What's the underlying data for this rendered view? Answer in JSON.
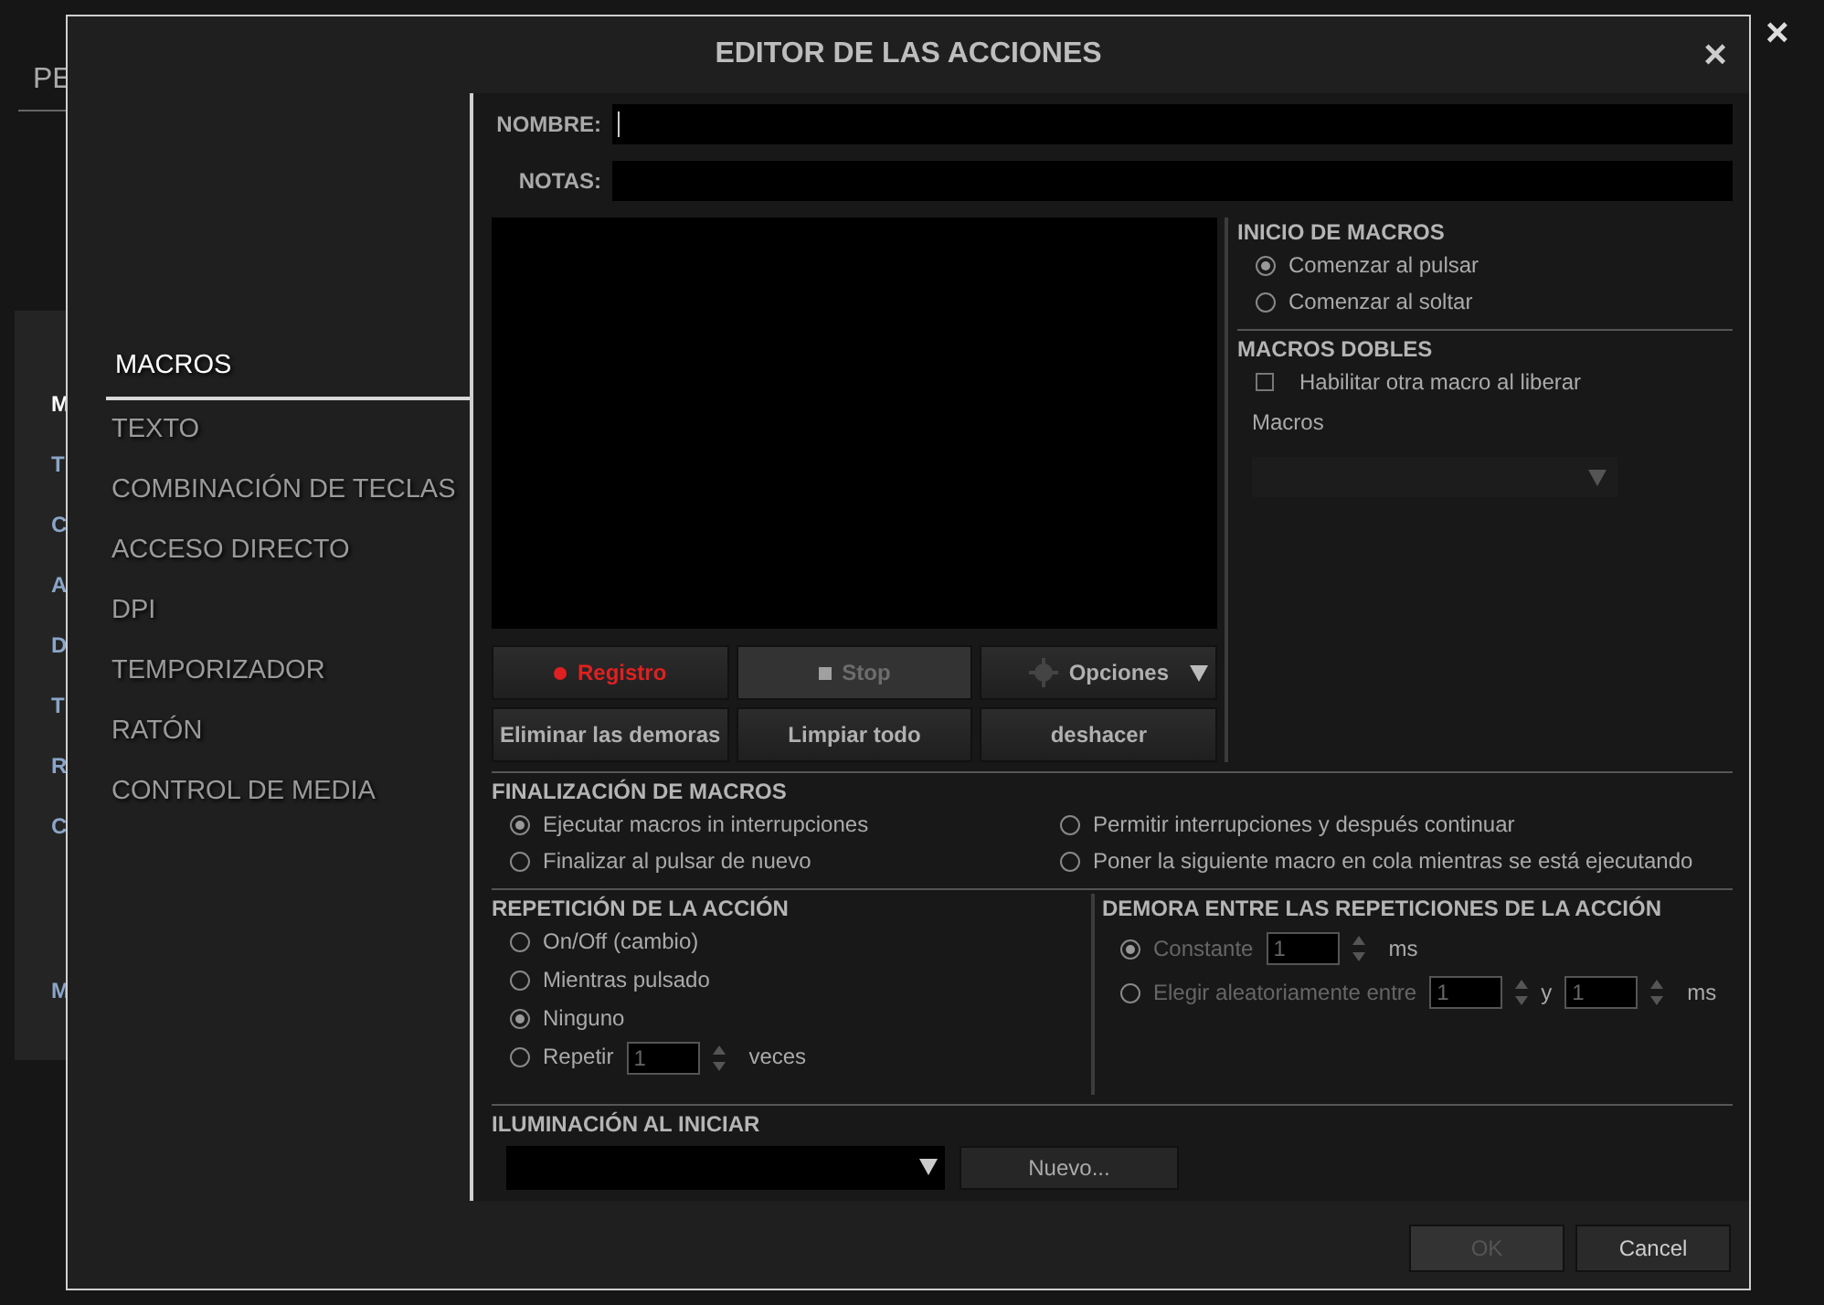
{
  "background": {
    "tab_label": "PE",
    "list_items": [
      "M",
      "T",
      "C",
      "A",
      "D",
      "T",
      "R",
      "C",
      "M"
    ],
    "close": "×"
  },
  "dialog": {
    "title": "EDITOR DE LAS ACCIONES",
    "close": "×"
  },
  "sidebar": {
    "items": [
      {
        "label": "MACROS",
        "selected": true
      },
      {
        "label": "TEXTO",
        "selected": false
      },
      {
        "label": "COMBINACIÓN DE TECLAS",
        "selected": false
      },
      {
        "label": "ACCESO DIRECTO",
        "selected": false
      },
      {
        "label": "DPI",
        "selected": false
      },
      {
        "label": "TEMPORIZADOR",
        "selected": false
      },
      {
        "label": "RATÓN",
        "selected": false
      },
      {
        "label": "CONTROL DE MEDIA",
        "selected": false
      }
    ]
  },
  "fields": [
    {
      "label": "NOMBRE:",
      "focused": true
    },
    {
      "label": "NOTAS:",
      "focused": false
    }
  ],
  "editor_buttons": [
    {
      "label": "Registro",
      "kind": "record",
      "disabled": false
    },
    {
      "label": "Stop",
      "kind": "stop",
      "disabled": true
    },
    {
      "label": "Opciones",
      "kind": "options",
      "disabled": false
    },
    {
      "label": "Eliminar las demoras",
      "kind": "plain",
      "disabled": false
    },
    {
      "label": "Limpiar todo",
      "kind": "plain",
      "disabled": false
    },
    {
      "label": "deshacer",
      "kind": "plain",
      "disabled": false
    }
  ],
  "macro_start": {
    "title": "INICIO DE MACROS",
    "options": [
      {
        "label": "Comenzar al pulsar",
        "selected": true
      },
      {
        "label": "Comenzar al soltar",
        "selected": false
      }
    ]
  },
  "double_macros": {
    "title": "MACROS DOBLES",
    "checkbox": {
      "label": "Habilitar otra macro al liberar",
      "checked": false
    },
    "dropdown_label": "Macros"
  },
  "macro_end": {
    "title": "FINALIZACIÓN DE MACROS",
    "options": [
      {
        "label": "Ejecutar macros in interrupciones",
        "selected": true
      },
      {
        "label": "Permitir interrupciones y después continuar",
        "selected": false
      },
      {
        "label": "Finalizar al pulsar de nuevo",
        "selected": false
      },
      {
        "label": "Poner la siguiente macro en cola mientras se está ejecutando",
        "selected": false
      }
    ]
  },
  "repetition": {
    "title": "REPETICIÓN DE LA ACCIÓN",
    "options": [
      {
        "label": "On/Off (cambio)",
        "selected": false
      },
      {
        "label": "Mientras pulsado",
        "selected": false
      },
      {
        "label": "Ninguno",
        "selected": true
      },
      {
        "label": "Repetir",
        "selected": false,
        "values": [
          "1"
        ],
        "unit": "veces"
      }
    ]
  },
  "delay": {
    "title": "DEMORA ENTRE LAS REPETICIONES DE LA ACCIÓN",
    "disabled": true,
    "options": [
      {
        "label": "Constante",
        "selected": true,
        "values": [
          "1"
        ],
        "unit": "ms"
      },
      {
        "label": "Elegir aleatoriamente entre",
        "selected": false,
        "values": [
          "1",
          "1"
        ],
        "joiner": "y",
        "unit": "ms"
      }
    ]
  },
  "lighting": {
    "title": "ILUMINACIÓN AL INICIAR",
    "new_button": "Nuevo..."
  },
  "footer_buttons": [
    {
      "label": "OK",
      "disabled": true
    },
    {
      "label": "Cancel",
      "disabled": false
    }
  ]
}
